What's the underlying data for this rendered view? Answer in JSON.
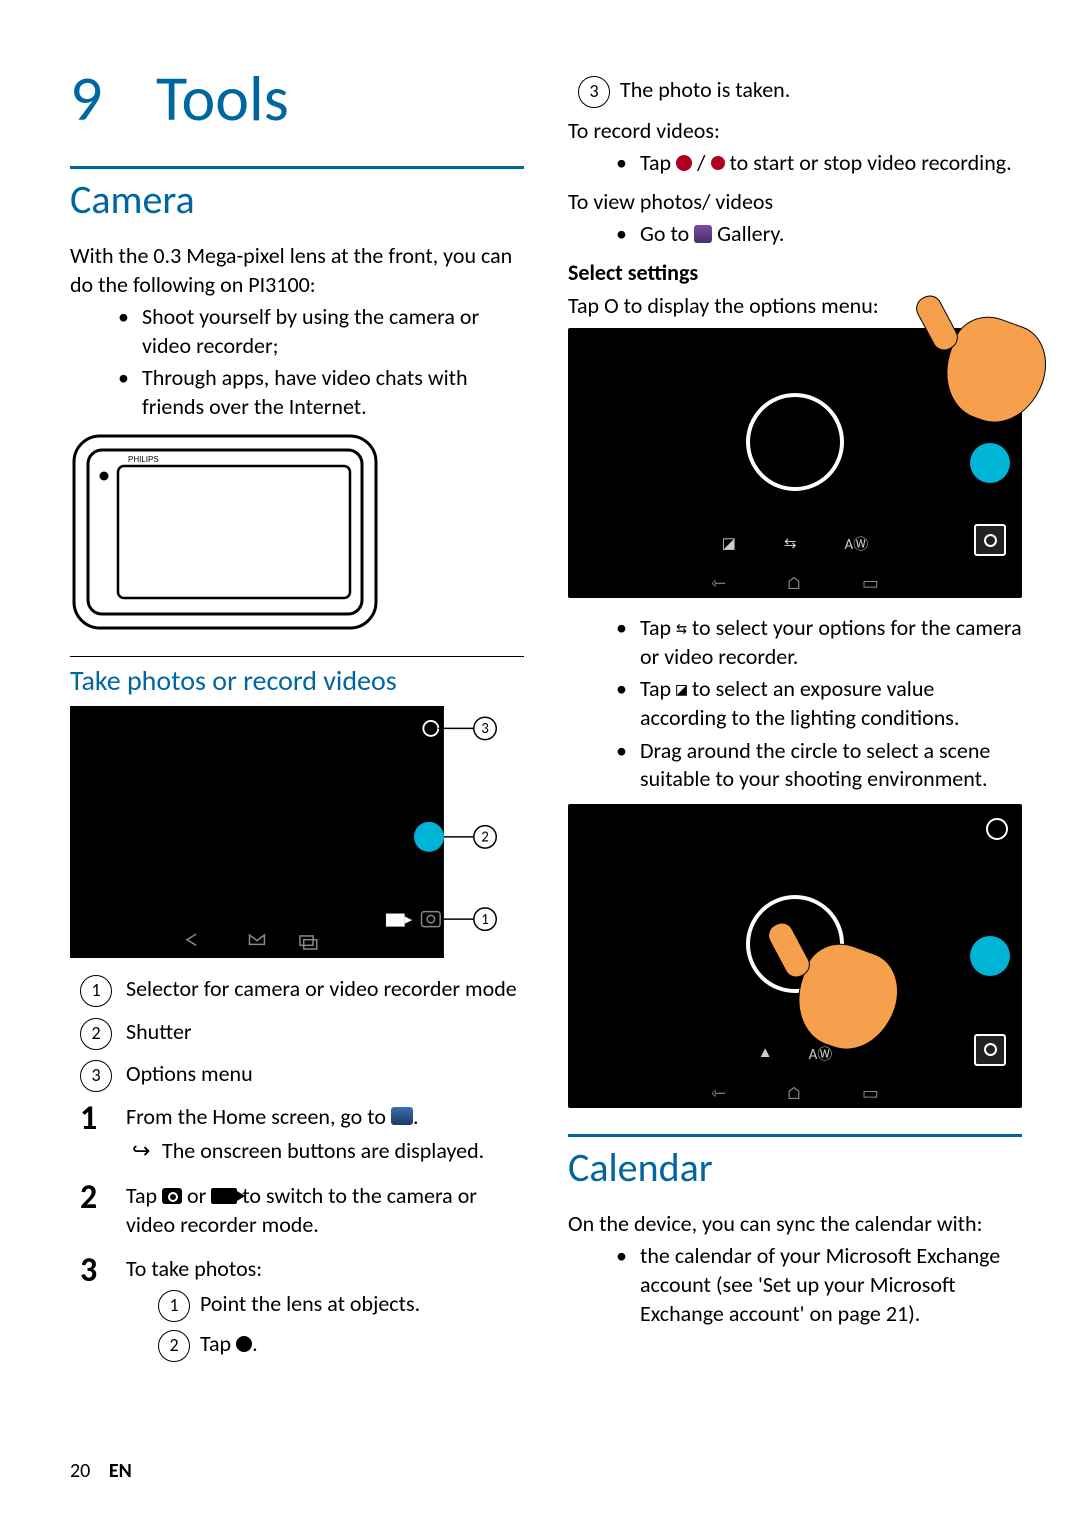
{
  "chapter": {
    "number": "9",
    "title": "Tools"
  },
  "camera": {
    "heading": "Camera",
    "intro": "With the 0.3 Mega-pixel lens at the front, you can do the following on PI3100:",
    "intro_bullets": [
      "Shoot yourself by using the camera or video recorder;",
      "Through apps, have video chats with friends over the Internet."
    ],
    "device_brand": "PHILIPS",
    "subsection": "Take photos or record videos",
    "callouts": [
      "Selector for camera or video recorder mode",
      "Shutter",
      "Options menu"
    ],
    "steps": {
      "s1_a": "From the Home screen, go to ",
      "s1_a_tail": ".",
      "s1_arrow": "The onscreen buttons are displayed.",
      "s2_a": "Tap ",
      "s2_b": " or ",
      "s2_c": " to switch to the camera or video recorder mode.",
      "s3_head": "To take photos:",
      "s3_1": "Point the lens at objects.",
      "s3_2a": "Tap ",
      "s3_2b": "."
    }
  },
  "right": {
    "s3_3": "The photo is taken.",
    "record_head": "To record videos:",
    "record_a": "Tap ",
    "record_b": " / ",
    "record_c": " to start or stop video recording.",
    "view_head": "To view photos/ videos",
    "view_a": "Go to ",
    "view_b": " Gallery.",
    "select_head": "Select settings",
    "select_intro": "Tap O to display the options menu:",
    "opts": {
      "a1": "Tap ",
      "a2": " to select your options for the camera or video recorder.",
      "b1": "Tap ",
      "b2": " to select an exposure value according to the lighting conditions.",
      "c": "Drag around the circle to select a scene suitable to your shooting environment."
    }
  },
  "calendar": {
    "heading": "Calendar",
    "intro": "On the device, you can sync the calendar with:",
    "bullet": "the calendar of your Microsoft Exchange account (see 'Set up your Microsoft Exchange account' on page 21)."
  },
  "footer": {
    "page": "20",
    "lang": "EN"
  },
  "icons": {
    "sliders_glyph": "⇆",
    "exposure_glyph": "◪"
  }
}
